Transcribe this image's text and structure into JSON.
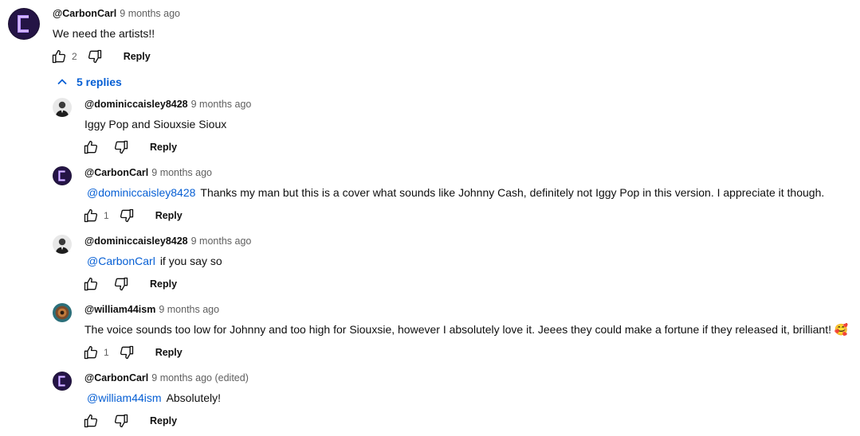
{
  "top_comment": {
    "author": "@CarbonCarl",
    "time": "9 months ago",
    "text": "We need the artists!!",
    "likes": "2",
    "reply_label": "Reply"
  },
  "replies_toggle": {
    "label": "5 replies"
  },
  "replies": [
    {
      "author": "@dominiccaisley8428",
      "time": "9 months ago",
      "mention": "",
      "text": "Iggy Pop and Siouxsie Sioux",
      "likes": "",
      "reply_label": "Reply"
    },
    {
      "author": "@CarbonCarl",
      "time": "9 months ago",
      "mention": "@dominiccaisley8428",
      "text": "Thanks my man but this is a cover what sounds like Johnny Cash, definitely not Iggy Pop in this version. I appreciate it though.",
      "likes": "1",
      "reply_label": "Reply"
    },
    {
      "author": "@dominiccaisley8428",
      "time": "9 months ago",
      "mention": "@CarbonCarl",
      "text": "if you say so",
      "likes": "",
      "reply_label": "Reply"
    },
    {
      "author": "@william44ism",
      "time": "9 months ago",
      "mention": "",
      "text": "The voice sounds too low for Johnny and too high for Siouxsie, however I absolutely love it. Jeees they could make a fortune if they released it, brilliant! 🥰",
      "likes": "1",
      "reply_label": "Reply"
    },
    {
      "author": "@CarbonCarl",
      "time": "9 months ago (edited)",
      "mention": "@william44ism",
      "text": "Absolutely!",
      "likes": "",
      "reply_label": "Reply"
    }
  ],
  "icons": {
    "like": "thumbs-up-icon",
    "dislike": "thumbs-down-icon",
    "toggle": "chevron-up-icon"
  },
  "colors": {
    "link": "#065fd4",
    "muted": "#606060",
    "carbon_avatar_bg": "#1a1030",
    "carbon_avatar_fg": "#9b6bff"
  }
}
